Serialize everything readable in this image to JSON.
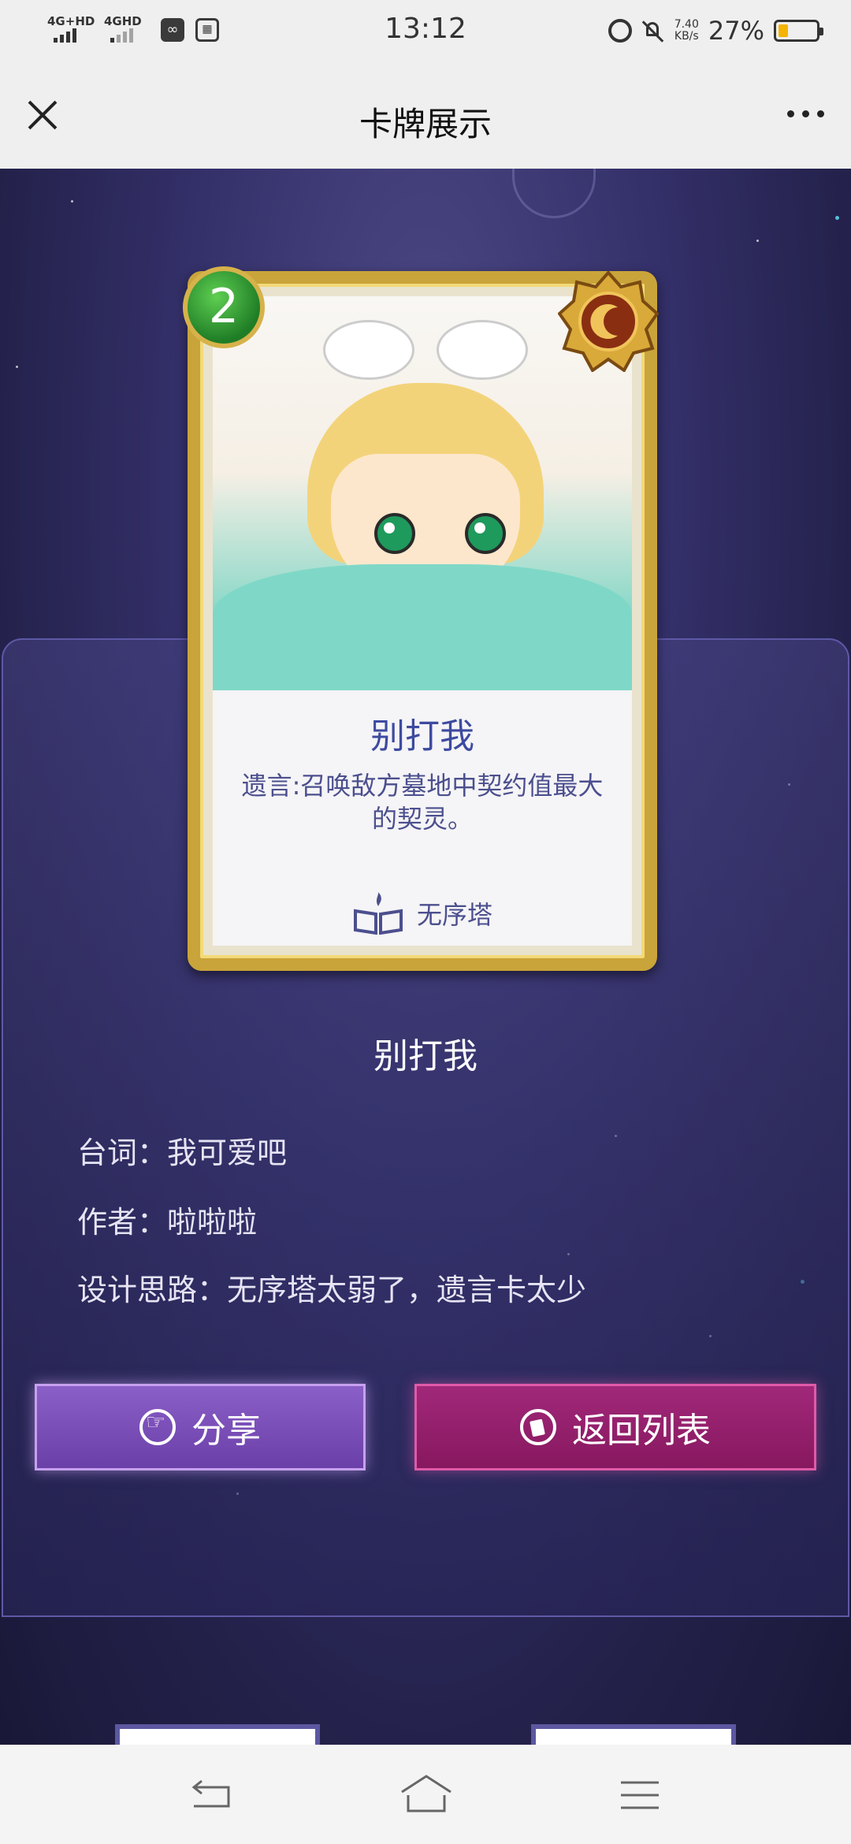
{
  "status_bar": {
    "net1": "4G+HD",
    "net2": "4GHD",
    "time": "13:12",
    "speed_value": "7.40",
    "speed_unit": "KB/s",
    "battery_text": "27%",
    "battery_level": 0.27,
    "battery_color": "#f4b400"
  },
  "header": {
    "title": "卡牌展示",
    "close_icon": "close-icon",
    "more_icon": "more-icon"
  },
  "card": {
    "cost": "2",
    "name": "别打我",
    "description": "遗言:召唤敌方墓地中契约值最大的契灵。",
    "faction": "无序塔",
    "faction_icon": "book-icon",
    "class_icon": "sun-moon-icon"
  },
  "info": {
    "name": "别打我",
    "lines_label": "台词：",
    "lines_value": "我可爱吧",
    "author_label": "作者：",
    "author_value": "啦啦啦",
    "design_label": "设计思路：",
    "design_value": "无序塔太弱了，遗言卡太少"
  },
  "buttons": {
    "share": "分享",
    "back_to_list": "返回列表"
  },
  "colors": {
    "share_button": "#7a4fb8",
    "back_button": "#95206c",
    "background": "#34306a"
  }
}
